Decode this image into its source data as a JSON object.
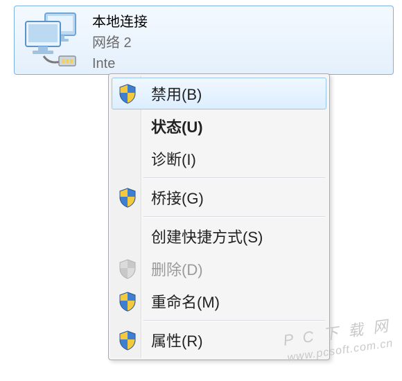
{
  "connection": {
    "title": "本地连接",
    "subtitle": "网络  2",
    "detail": "Inte"
  },
  "menu": {
    "items": [
      {
        "label": "禁用(B)",
        "shield": true,
        "bold": false,
        "disabled": false,
        "hovered": true
      },
      {
        "label": "状态(U)",
        "shield": false,
        "bold": true,
        "disabled": false,
        "hovered": false
      },
      {
        "label": "诊断(I)",
        "shield": false,
        "bold": false,
        "disabled": false,
        "hovered": false
      },
      {
        "sep": true
      },
      {
        "label": "桥接(G)",
        "shield": true,
        "bold": false,
        "disabled": false,
        "hovered": false
      },
      {
        "sep": true
      },
      {
        "label": "创建快捷方式(S)",
        "shield": false,
        "bold": false,
        "disabled": false,
        "hovered": false
      },
      {
        "label": "删除(D)",
        "shield": true,
        "bold": false,
        "disabled": true,
        "hovered": false,
        "shieldDisabled": true
      },
      {
        "label": "重命名(M)",
        "shield": true,
        "bold": false,
        "disabled": false,
        "hovered": false
      },
      {
        "sep": true
      },
      {
        "label": "属性(R)",
        "shield": true,
        "bold": false,
        "disabled": false,
        "hovered": false
      }
    ]
  },
  "watermark": {
    "line1": "P C 下 载 网",
    "line2": "www.pcsoft.com.cn"
  }
}
